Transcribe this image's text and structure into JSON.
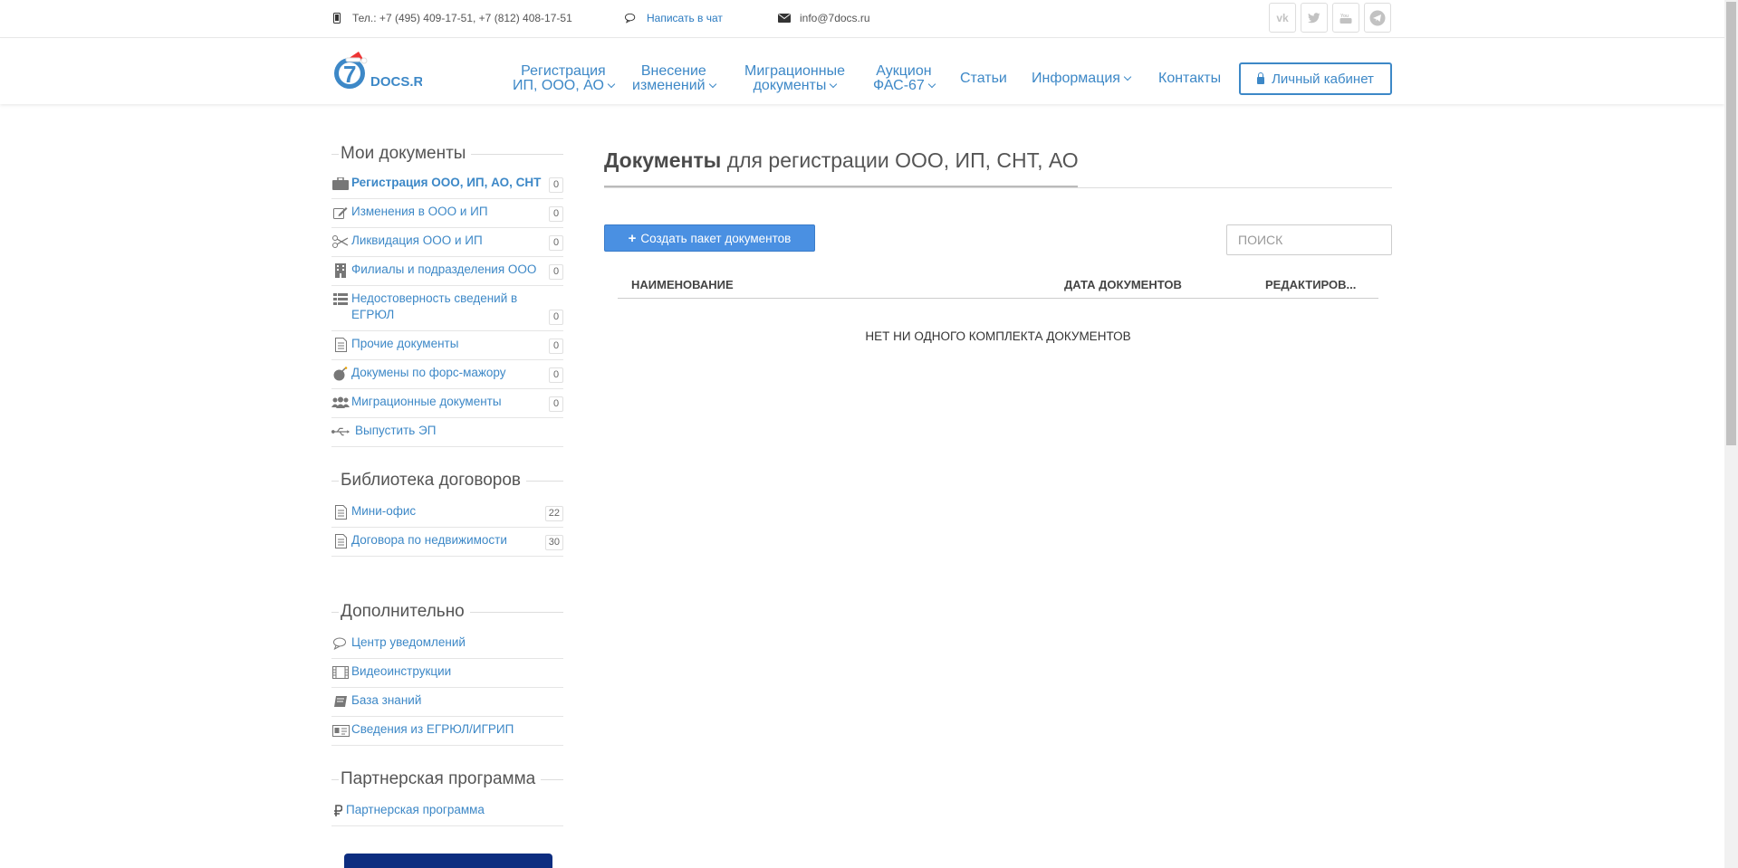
{
  "topbar": {
    "phone": "Тел.: +7 (495) 409-17-51, +7 (812) 408-17-51",
    "chat": "Написать в чат",
    "email": "info@7docs.ru",
    "social": [
      "vk-icon",
      "twitter-icon",
      "youtube-icon",
      "telegram-icon"
    ]
  },
  "header": {
    "logo_text": "DOCS.RU",
    "logo_digit": "7",
    "nav": [
      {
        "line1": "Регистрация",
        "line2": "ИП, ООО, АО"
      },
      {
        "line1": "Внесение",
        "line2": "изменений"
      },
      {
        "line1": "Миграционные",
        "line2": "документы"
      },
      {
        "line1": "Аукцион",
        "line2": "ФАС-67"
      },
      {
        "label": "Статьи"
      },
      {
        "label": "Информация"
      },
      {
        "label": "Контакты"
      }
    ],
    "cabinet": "Личный кабинет"
  },
  "sidebar": {
    "my_docs_title": "Мои документы",
    "my_docs": [
      {
        "label": "Регистрация ООО, ИП, АО, СНТ",
        "count": "0",
        "icon": "briefcase-icon"
      },
      {
        "label": "Изменения в ООО и ИП",
        "count": "0",
        "icon": "edit-icon"
      },
      {
        "label": "Ликвидация ООО и ИП",
        "count": "0",
        "icon": "scissors-icon"
      },
      {
        "label": "Филиалы и подразделения ООО",
        "count": "0",
        "icon": "building-icon"
      },
      {
        "label": "Недостоверность сведений в ЕГРЮЛ",
        "count": "0",
        "icon": "list-icon"
      },
      {
        "label": "Прочие документы",
        "count": "0",
        "icon": "document-icon"
      },
      {
        "label": "Докумены по форс-мажору",
        "count": "0",
        "icon": "bomb-icon"
      },
      {
        "label": "Миграционные документы",
        "count": "0",
        "icon": "users-icon"
      },
      {
        "label": "Выпустить ЭП",
        "icon": "usb-icon"
      }
    ],
    "library_title": "Библиотека договоров",
    "library": [
      {
        "label": "Мини-офис",
        "count": "22",
        "icon": "document-icon"
      },
      {
        "label": "Договора по недвижимости",
        "count": "30",
        "icon": "document-icon"
      }
    ],
    "extra_title": "Дополнительно",
    "extra": [
      {
        "label": "Центр уведомлений",
        "icon": "comments-icon"
      },
      {
        "label": "Видеоинструкции",
        "icon": "film-icon"
      },
      {
        "label": "База знаний",
        "icon": "book-icon"
      },
      {
        "label": "Сведения из ЕГРЮЛ/ИГРИП",
        "icon": "id-card-icon"
      }
    ],
    "partner_title": "Партнерская программа",
    "partner": [
      {
        "label": "Партнерская программа",
        "icon": "ruble-icon"
      }
    ]
  },
  "main": {
    "title_bold": "Документы",
    "title_rest": " для регистрации ООО, ИП, СНТ, АО",
    "create_button": "Создать пакет документов",
    "search_placeholder": "ПОИСК",
    "columns": [
      "НАИМЕНОВАНИЕ",
      "ДАТА ДОКУМЕНТОВ",
      "РЕДАКТИРОВ..."
    ],
    "empty_text": "НЕТ НИ ОДНОГО КОМПЛЕКТА ДОКУМЕНТОВ"
  },
  "colors": {
    "link": "#3d88c7",
    "primary_button": "#4a90e2",
    "dark_button": "#0d2d80"
  }
}
